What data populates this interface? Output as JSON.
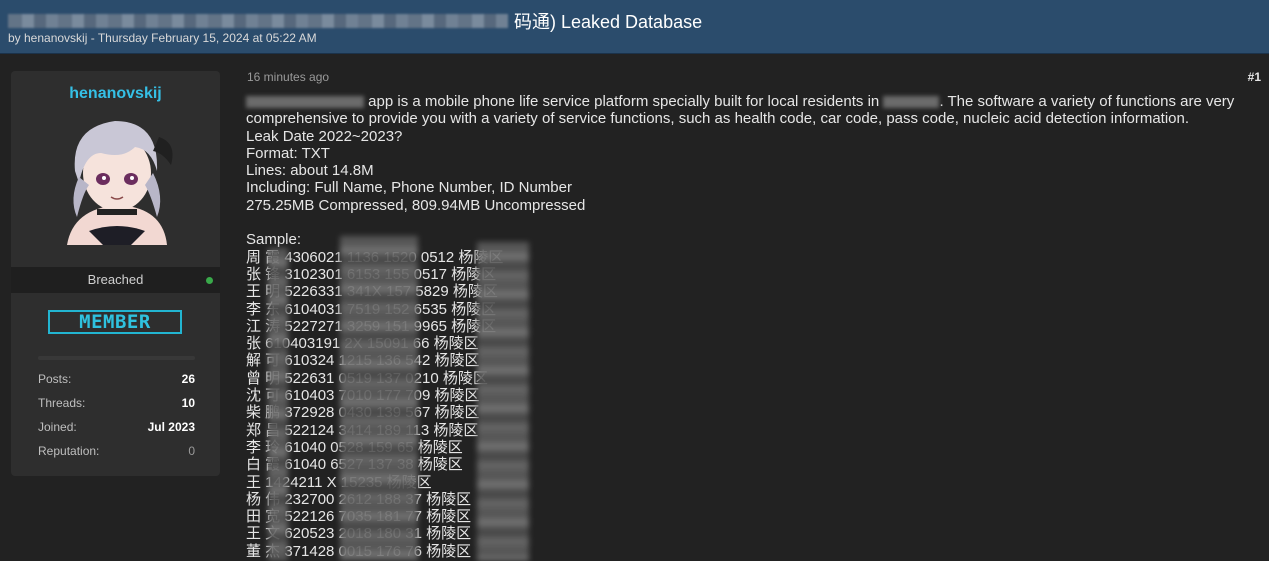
{
  "thread": {
    "title_suffix": "码通) Leaked Database",
    "byline": "by henanovskij - Thursday February 15, 2024 at 05:22 AM"
  },
  "author": {
    "username": "henanovskij",
    "status": "Breached",
    "badge": "MEMBER",
    "stats": [
      {
        "label": "Posts:",
        "value": "26"
      },
      {
        "label": "Threads:",
        "value": "10"
      },
      {
        "label": "Joined:",
        "value": "Jul 2023"
      },
      {
        "label": "Reputation:",
        "value": "0"
      }
    ]
  },
  "post": {
    "time": "16 minutes ago",
    "number": "#1",
    "intro_a": "app is a mobile phone life service platform specially built for local residents in",
    "intro_b": ". The software a variety of functions are very comprehensive to provide you with a variety of service functions, such as health code, car code, pass code, nucleic acid detection information.",
    "leak_date": "Leak Date 2022~2023?",
    "format": "Format: TXT",
    "lines": "Lines: about 14.8M",
    "including": "Including: Full Name, Phone Number, ID Number",
    "size": "275.25MB Compressed, 809.94MB Uncompressed",
    "sample_label": "Sample:",
    "sample_rows": [
      "周  霞 4306021          1136 1520      0512 杨陵区",
      "张  锋 3102301          6153 155       0517 杨陵区",
      "王  明 5226331          341X 157       5829 杨陵区",
      "李  东 6104031          7519 152       6535 杨陵区",
      "江  涛 5227271          3259 151       9965 杨陵区",
      "张  610403191              2X 15091       66 杨陵区",
      "解  可 610324             1215 136        542 杨陵区",
      "曾  明 522631             0519 137        0210 杨陵区",
      "沈  可 610403             7010 177        709 杨陵区",
      "柴  鹏 372928             0430 139        567 杨陵区",
      "郑  昌 522124             3414 189        113 杨陵区",
      "李  玲 61040              0528 159        65 杨陵区",
      "白  霞 61040              6527 137        38 杨陵区",
      "王  1424211                X 15235         杨陵区",
      "杨  伟 232700             2612 188        37 杨陵区",
      "田  宽 522126             7035 181        77 杨陵区",
      "王  文 620523             2018 180        31 杨陵区",
      "董  杰 371428             0015 176        76 杨陵区"
    ]
  }
}
